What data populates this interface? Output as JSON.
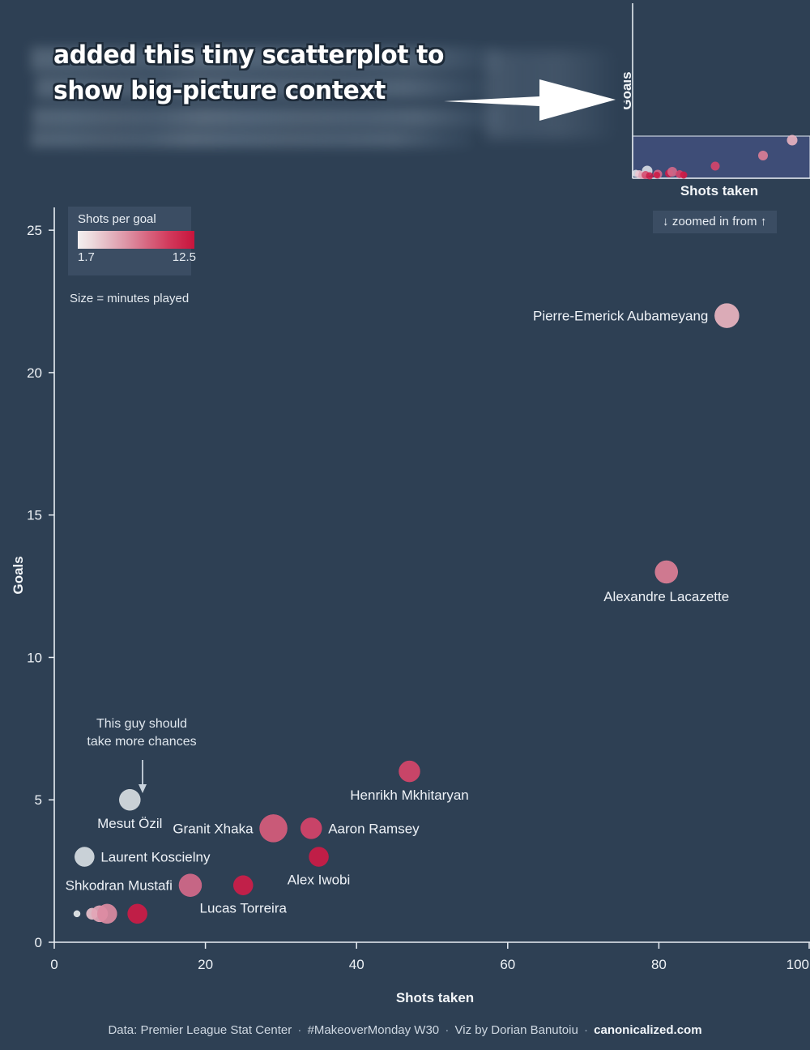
{
  "annotation": {
    "headline": "added this tiny scatterplot to\nshow big-picture context",
    "arrow_icon": "right-arrow-icon"
  },
  "minimap": {
    "xlabel": "Shots taken",
    "ylabel": "Goals",
    "zoom_note": "↓ zoomed in from ↑",
    "highlight_color": "#3e4d77"
  },
  "legend": {
    "title": "Shots per goal",
    "min": "1.7",
    "max": "12.5",
    "size_note": "Size = minutes played",
    "gradient_start": "#f2eff0",
    "gradient_end": "#c8143c",
    "panel_color": "#3b4d63"
  },
  "callout": {
    "line1": "This guy should",
    "line2": "take more chances",
    "arrow_icon": "down-arrow-icon"
  },
  "footer": {
    "data_source": "Data: Premier League Stat Center",
    "hashtag": "#MakeoverMonday W30",
    "viz_credit": "Viz by Dorian Banutoiu",
    "site": "canonicalized.com",
    "separator": "·"
  },
  "chart_data": {
    "type": "scatter",
    "title": "",
    "xlabel": "Shots taken",
    "ylabel": "Goals",
    "xlim": [
      0,
      100
    ],
    "ylim": [
      0,
      25.8
    ],
    "xticks": [
      0,
      20,
      40,
      60,
      80,
      100
    ],
    "yticks": [
      0,
      5,
      10,
      15,
      20,
      25
    ],
    "grid": false,
    "size_encoding": "minutes played",
    "color_encoding": "shots per goal",
    "color_range": [
      1.7,
      12.5
    ],
    "points": [
      {
        "name": "Pierre-Emerick Aubameyang",
        "shots": 89,
        "goals": 22,
        "shots_per_goal": 4.0,
        "size": 15,
        "color": "#eab4c0",
        "label_side": "left"
      },
      {
        "name": "Alexandre Lacazette",
        "shots": 81,
        "goals": 13,
        "shots_per_goal": 6.2,
        "size": 14,
        "color": "#dd7e96",
        "label_side": "below"
      },
      {
        "name": "Henrikh Mkhitaryan",
        "shots": 47,
        "goals": 6,
        "shots_per_goal": 7.8,
        "size": 13,
        "color": "#d6456a",
        "label_side": "below"
      },
      {
        "name": "Granit Xhaka",
        "shots": 29,
        "goals": 4,
        "shots_per_goal": 7.3,
        "size": 17,
        "color": "#d75c7c",
        "label_side": "left"
      },
      {
        "name": "Aaron Ramsey",
        "shots": 34,
        "goals": 4,
        "shots_per_goal": 8.5,
        "size": 13,
        "color": "#d6436a",
        "label_side": "right"
      },
      {
        "name": "Alex Iwobi",
        "shots": 35,
        "goals": 3,
        "shots_per_goal": 11.7,
        "size": 12,
        "color": "#cd1b46",
        "label_side": "below"
      },
      {
        "name": "Mesut Özil",
        "shots": 10,
        "goals": 5,
        "shots_per_goal": 2.0,
        "size": 13,
        "color": "#d8dde2",
        "label_side": "below"
      },
      {
        "name": "Laurent Koscielny",
        "shots": 4,
        "goals": 3,
        "shots_per_goal": 1.7,
        "size": 12,
        "color": "#d7dde3",
        "label_side": "right"
      },
      {
        "name": "Shkodran Mustafi",
        "shots": 18,
        "goals": 2,
        "shots_per_goal": 9.0,
        "size": 14,
        "color": "#d4698a",
        "label_side": "left"
      },
      {
        "name": "Lucas Torreira",
        "shots": 25,
        "goals": 2,
        "shots_per_goal": 12.5,
        "size": 12,
        "color": "#ce1d49",
        "label_side": "below"
      },
      {
        "name": "",
        "shots": 3,
        "goals": 1,
        "shots_per_goal": 3.0,
        "size": 4,
        "color": "#e6e9ec",
        "label_side": "none"
      },
      {
        "name": "",
        "shots": 5,
        "goals": 1,
        "shots_per_goal": 5.0,
        "size": 7,
        "color": "#e9bfcb",
        "label_side": "none"
      },
      {
        "name": "",
        "shots": 6,
        "goals": 1,
        "shots_per_goal": 6.0,
        "size": 10,
        "color": "#e3a5b6",
        "label_side": "none"
      },
      {
        "name": "",
        "shots": 7,
        "goals": 1,
        "shots_per_goal": 7.0,
        "size": 12,
        "color": "#dc8ba2",
        "label_side": "none"
      },
      {
        "name": "",
        "shots": 11,
        "goals": 1,
        "shots_per_goal": 11.0,
        "size": 12,
        "color": "#cd1b46",
        "label_side": "none"
      }
    ]
  }
}
